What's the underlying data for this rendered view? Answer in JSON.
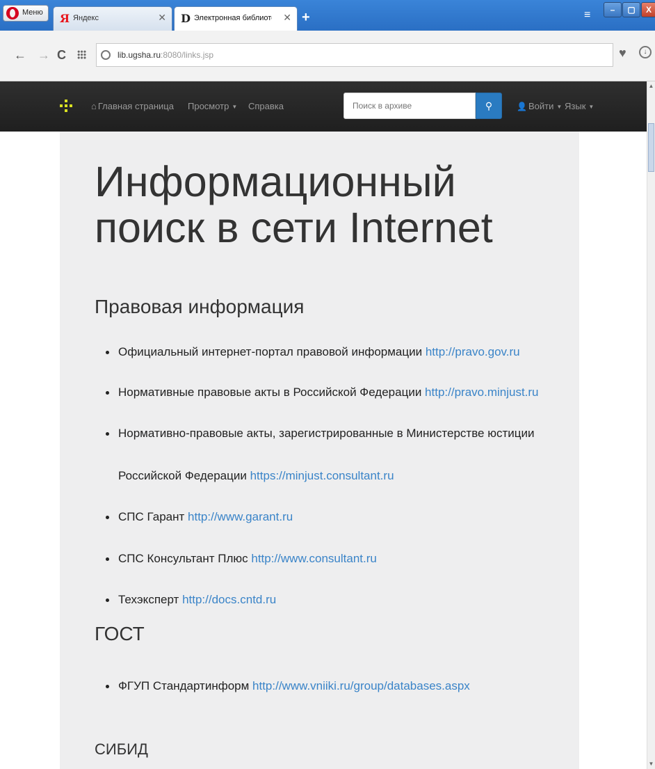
{
  "browser": {
    "menu_label": "Меню",
    "tabs": [
      {
        "label": "Яндекс",
        "favicon": "Я"
      },
      {
        "label": "Электронная библиотека У",
        "favicon": "D"
      }
    ],
    "newtab_symbol": "+",
    "close_symbol": "X",
    "url_host": "lib.ugsha.ru",
    "url_rest": ":8080/links.jsp"
  },
  "navbar": {
    "home": "Главная страница",
    "browse": "Просмотр",
    "help": "Справка",
    "search_placeholder": "Поиск в архиве",
    "login": "Войти",
    "language": "Язык"
  },
  "page": {
    "title": "Информационный поиск в сети Internet",
    "sections": [
      {
        "heading": "Правовая информация",
        "items": [
          {
            "text": "Официальный интернет-портал правовой информации ",
            "link": "http://pravo.gov.ru"
          },
          {
            "text": "Нормативные правовые акты в Российской Федерации ",
            "link": "http://pravo.minjust.ru"
          },
          {
            "text": "Нормативно-правовые акты, зарегистрированные в Министерстве юстиции",
            "text2": "Российской Федерации ",
            "link": "https://minjust.consultant.ru"
          },
          {
            "text": "СПС Гарант ",
            "link": "http://www.garant.ru"
          },
          {
            "text": "СПС Консультант Плюс ",
            "link": "http://www.consultant.ru"
          },
          {
            "text": "Техэксперт ",
            "link": "http://docs.cntd.ru"
          }
        ]
      },
      {
        "heading": "ГОСТ",
        "items": [
          {
            "text": "ФГУП Стандартинформ ",
            "link": "http://www.vniiki.ru/group/databases.aspx"
          }
        ]
      },
      {
        "heading": "СИБИД",
        "items": []
      }
    ]
  },
  "colors": {
    "link": "#3a84c8",
    "navbar_bg": "#222222",
    "search_button": "#2a7bc1",
    "logo": "#d9e021"
  }
}
